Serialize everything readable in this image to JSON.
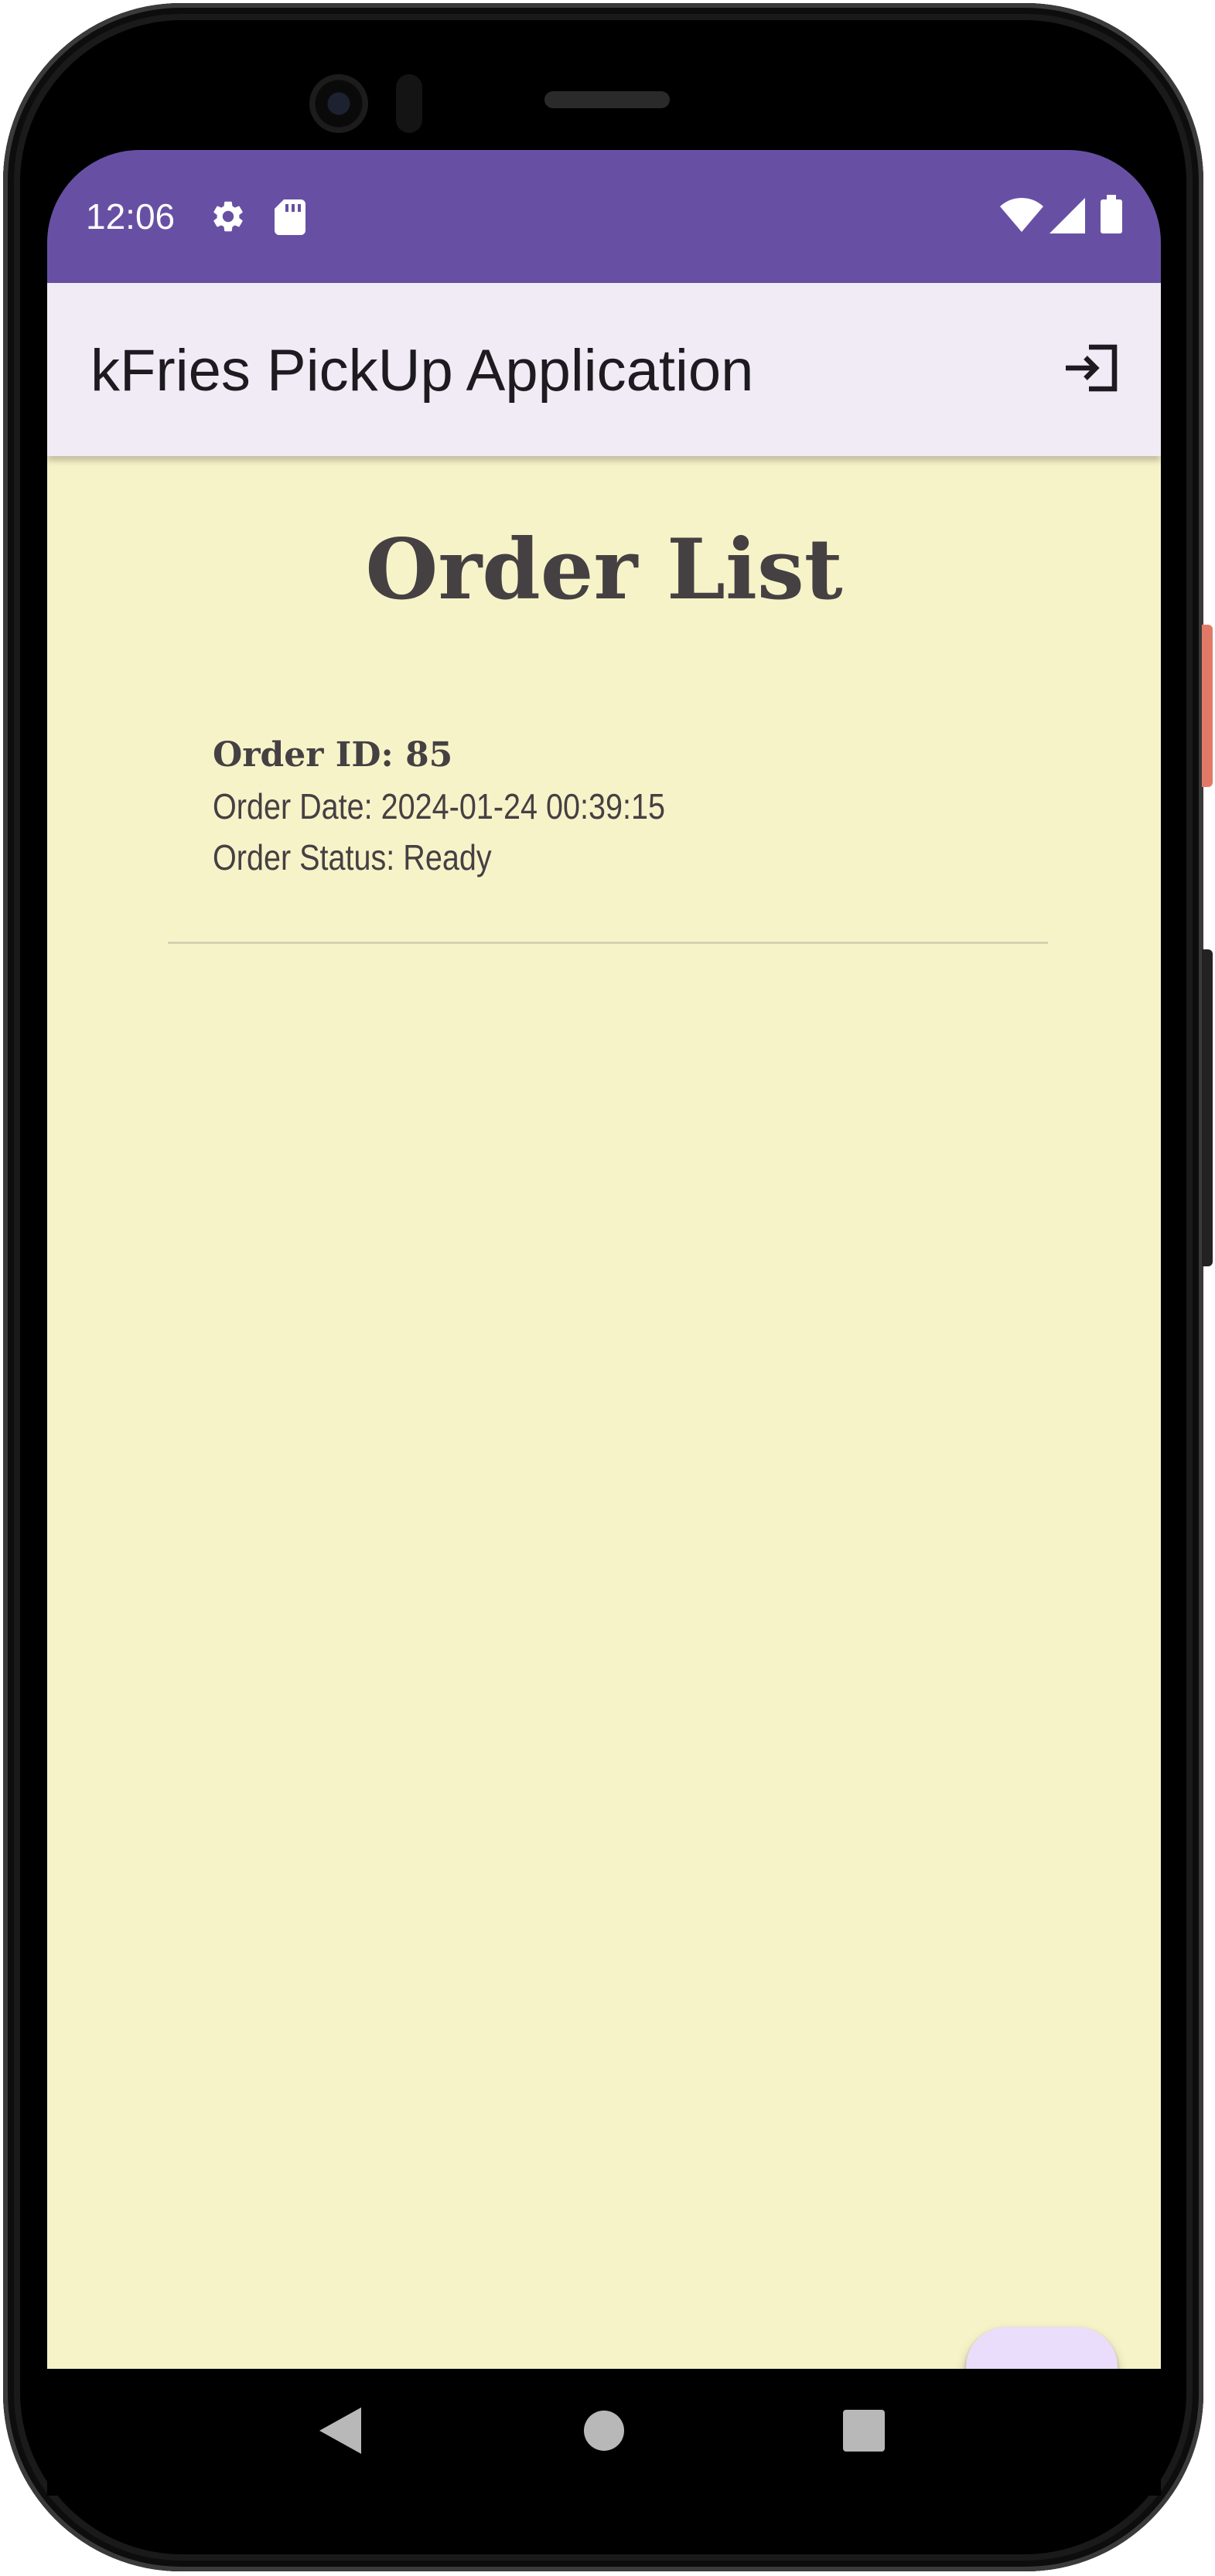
{
  "status_bar": {
    "time": "12:06",
    "icons": [
      "gear-icon",
      "sd-card-icon",
      "wifi-icon",
      "signal-icon",
      "battery-icon"
    ],
    "background": "#6750a4"
  },
  "app_bar": {
    "title": "kFries PickUp Application",
    "action_icon": "logout-icon",
    "background": "#f1ebf6"
  },
  "main": {
    "title": "Order List",
    "background": "#f7f3c9",
    "orders": [
      {
        "id_text": "Order ID: 85",
        "date_text": "Order Date: 2024-01-24 00:39:15",
        "status_text": "Order Status: Ready"
      }
    ]
  },
  "fab": {
    "icon": "plus-icon",
    "background": "#eaddfc"
  },
  "nav_bar": {
    "icons": [
      "back-icon",
      "home-icon",
      "recents-icon"
    ]
  }
}
